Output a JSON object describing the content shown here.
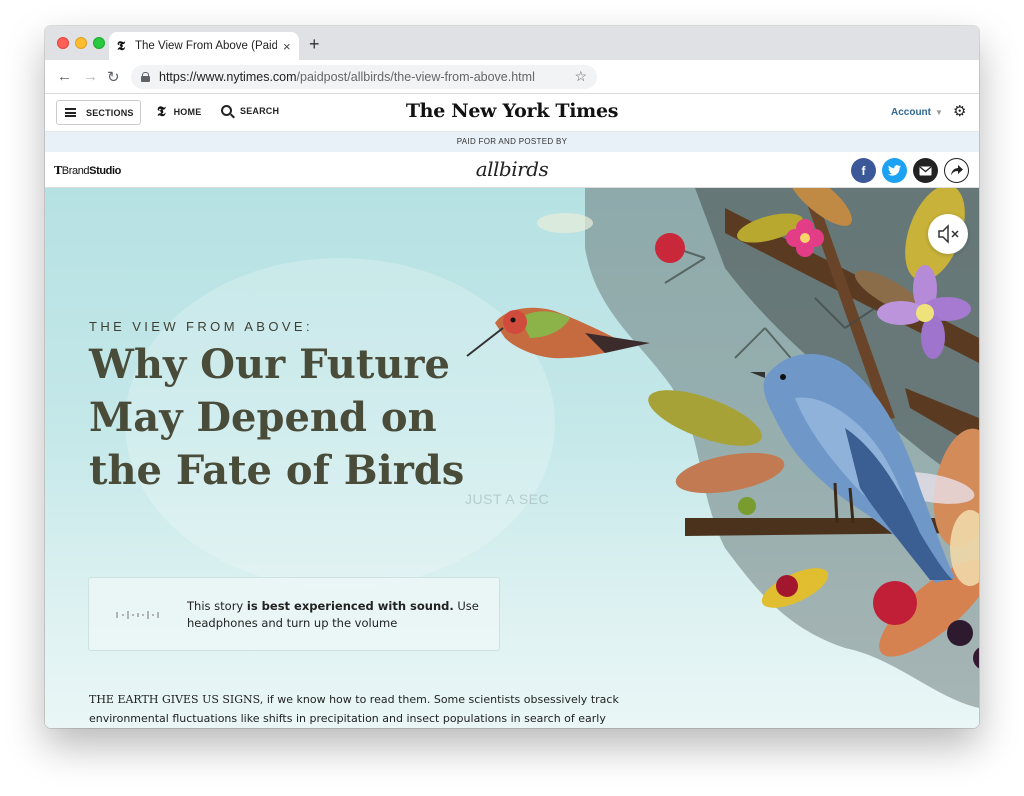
{
  "browser": {
    "tab_title": "The View From Above (Paid Po",
    "tab_favicon": "𝕿",
    "url_scheme_host": "https://www.nytimes.com",
    "url_path": "/paidpost/allbirds/the-view-from-above.html",
    "new_tab_symbol": "+",
    "close_symbol": "×"
  },
  "header": {
    "sections_label": "SECTIONS",
    "home_label": "HOME",
    "search_label": "SEARCH",
    "masthead": "The New York Times",
    "account_label": "Account"
  },
  "paid_strip": {
    "text": "PAID FOR AND POSTED BY"
  },
  "brand_bar": {
    "brandstudio_t": "T",
    "brandstudio_brand": "Brand",
    "brandstudio_studio": "Studio",
    "sponsor_logo": "allbirds",
    "social": [
      {
        "icon": "facebook-icon",
        "glyph": "f",
        "color": "#3b5998"
      },
      {
        "icon": "twitter-icon",
        "glyph": "t",
        "color": "#1da1f2"
      },
      {
        "icon": "email-icon",
        "glyph": "✉",
        "color": "#222222"
      },
      {
        "icon": "share-icon",
        "glyph": "↪",
        "color": "#ffffff"
      }
    ]
  },
  "hero": {
    "kicker": "THE VIEW FROM ABOVE:",
    "headline_lines": [
      "Why Our Future",
      "May Depend on",
      "the Fate of Birds"
    ],
    "loading_text": "JUST A SEC",
    "sound_notice": {
      "prefix": "This story ",
      "bold": "is best experienced with sound.",
      "suffix": " Use headphones and turn up the volume"
    },
    "body_lead": "THE EARTH GIVES US SIGNS,",
    "body_line1": " if we know how to read them. Some scientists obsessively track",
    "body_line2": "environmental fluctuations like shifts in precipitation and insect populations in search of early"
  },
  "colors": {
    "hero_bg": "#b6e1e3",
    "headline": "#4a4c3a",
    "account_link": "#326891",
    "paid_strip_bg": "#e8f1f8"
  }
}
